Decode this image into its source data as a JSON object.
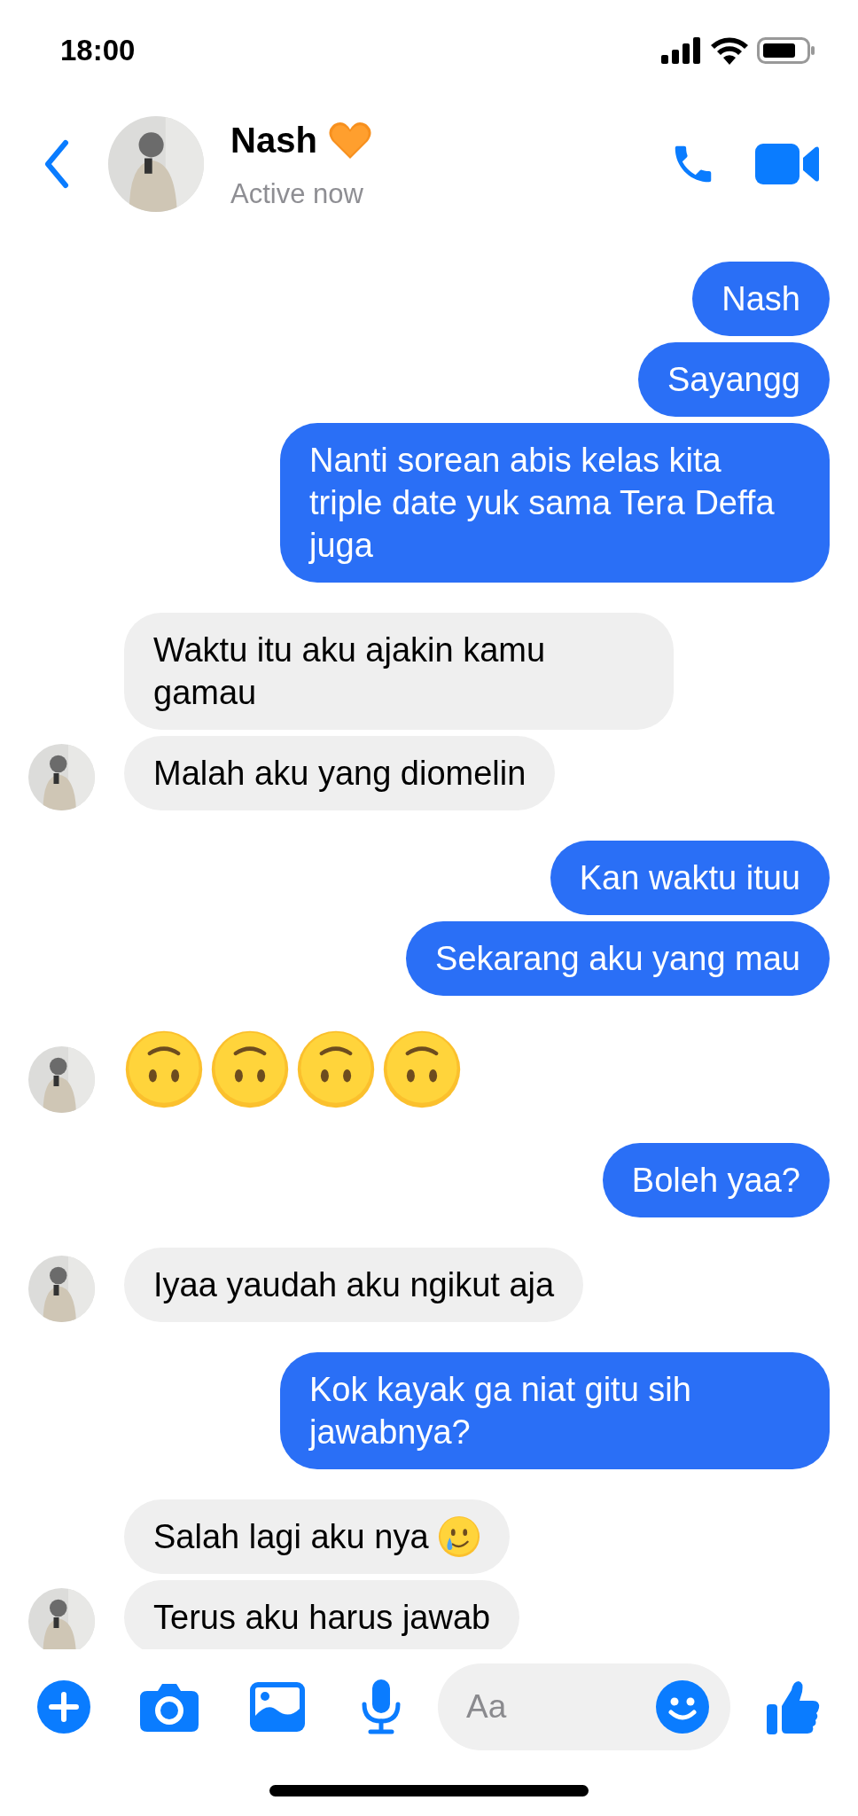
{
  "status_bar": {
    "time": "18:00"
  },
  "header": {
    "name": "Nash",
    "name_badge": {
      "kind": "orange-heart"
    },
    "status": "Active now"
  },
  "messages": [
    {
      "outgoing": true,
      "kind": "text",
      "text": "Nash"
    },
    {
      "outgoing": true,
      "kind": "text",
      "text": "Sayangg"
    },
    {
      "outgoing": true,
      "kind": "text",
      "text": "Nanti sorean abis kelas kita triple date yuk sama Tera Deffa juga"
    },
    {
      "outgoing": false,
      "kind": "text",
      "text": "Waktu itu aku ajakin kamu gamau"
    },
    {
      "outgoing": false,
      "kind": "text",
      "text": "Malah aku yang diomelin"
    },
    {
      "outgoing": true,
      "kind": "text",
      "text": "Kan waktu ituu"
    },
    {
      "outgoing": true,
      "kind": "text",
      "text": "Sekarang aku yang mau"
    },
    {
      "outgoing": false,
      "kind": "emoji",
      "items": [
        {
          "kind": "upside-down-face"
        },
        {
          "kind": "upside-down-face"
        },
        {
          "kind": "upside-down-face"
        },
        {
          "kind": "upside-down-face"
        }
      ]
    },
    {
      "outgoing": true,
      "kind": "text",
      "text": "Boleh yaa?"
    },
    {
      "outgoing": false,
      "kind": "text",
      "text": "Iyaa yaudah aku ngikut aja"
    },
    {
      "outgoing": true,
      "kind": "text",
      "text": "Kok kayak ga niat gitu sih jawabnya?"
    },
    {
      "outgoing": false,
      "kind": "text",
      "text": "Salah lagi aku nya",
      "trailing_icon": {
        "kind": "smiling-tear"
      }
    },
    {
      "outgoing": false,
      "kind": "text",
      "text": "Terus aku harus jawab"
    }
  ],
  "composer": {
    "placeholder": "Aa"
  }
}
